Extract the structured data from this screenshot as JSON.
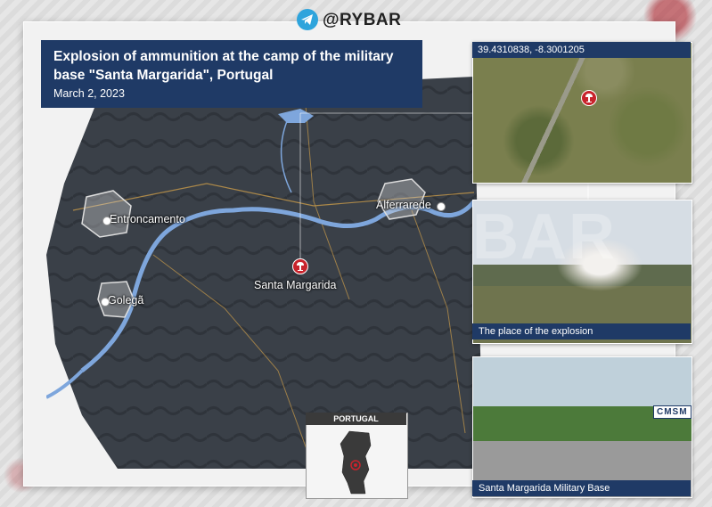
{
  "brand": {
    "handle": "@RYBAR",
    "icon": "telegram-icon",
    "watermark": "BAR"
  },
  "header": {
    "title": "Explosion of ammunition at the camp of the military base \"Santa Margarida\",  Portugal",
    "date": "March 2, 2023"
  },
  "map": {
    "places": [
      {
        "name": "Entroncamento",
        "type": "town"
      },
      {
        "name": "Alferrarede",
        "type": "town"
      },
      {
        "name": "Golegã",
        "type": "town"
      },
      {
        "name": "Santa Margarida",
        "type": "explosion-site",
        "icon": "explosion-marker-icon"
      }
    ],
    "river_color": "#7ea6dc",
    "header_color": "#1f3a66"
  },
  "photos": {
    "satellite": {
      "coordinates": "39.4310838, -8.3001205"
    },
    "explosion": {
      "caption": "The place of the explosion"
    },
    "base": {
      "caption": "Santa Margarida Military Base",
      "sign_text": "CMSM"
    }
  },
  "inset": {
    "title": "PORTUGAL"
  }
}
